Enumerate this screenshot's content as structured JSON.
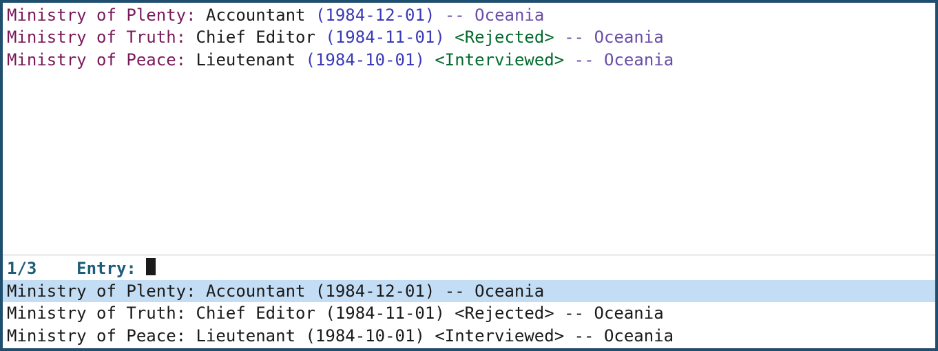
{
  "upper_entries": [
    {
      "ministry": "Ministry of Plenty",
      "position": "Accountant",
      "date": "1984-12-01",
      "status": "",
      "country": "Oceania"
    },
    {
      "ministry": "Ministry of Truth",
      "position": "Chief Editor",
      "date": "1984-11-01",
      "status": "<Rejected>",
      "country": "Oceania"
    },
    {
      "ministry": "Ministry of Peace",
      "position": "Lieutenant",
      "date": "1984-10-01",
      "status": "<Interviewed>",
      "country": "Oceania"
    }
  ],
  "prompt": {
    "counter": "1/3",
    "spacer": "    ",
    "label": "Entry:",
    "gap": " "
  },
  "lower_entries": [
    {
      "text": "Ministry of Plenty: Accountant (1984-12-01) -- Oceania",
      "selected": true
    },
    {
      "text": "Ministry of Truth: Chief Editor (1984-11-01) <Rejected> -- Oceania",
      "selected": false
    },
    {
      "text": "Ministry of Peace: Lieutenant (1984-10-01) <Interviewed> -- Oceania",
      "selected": false
    }
  ]
}
